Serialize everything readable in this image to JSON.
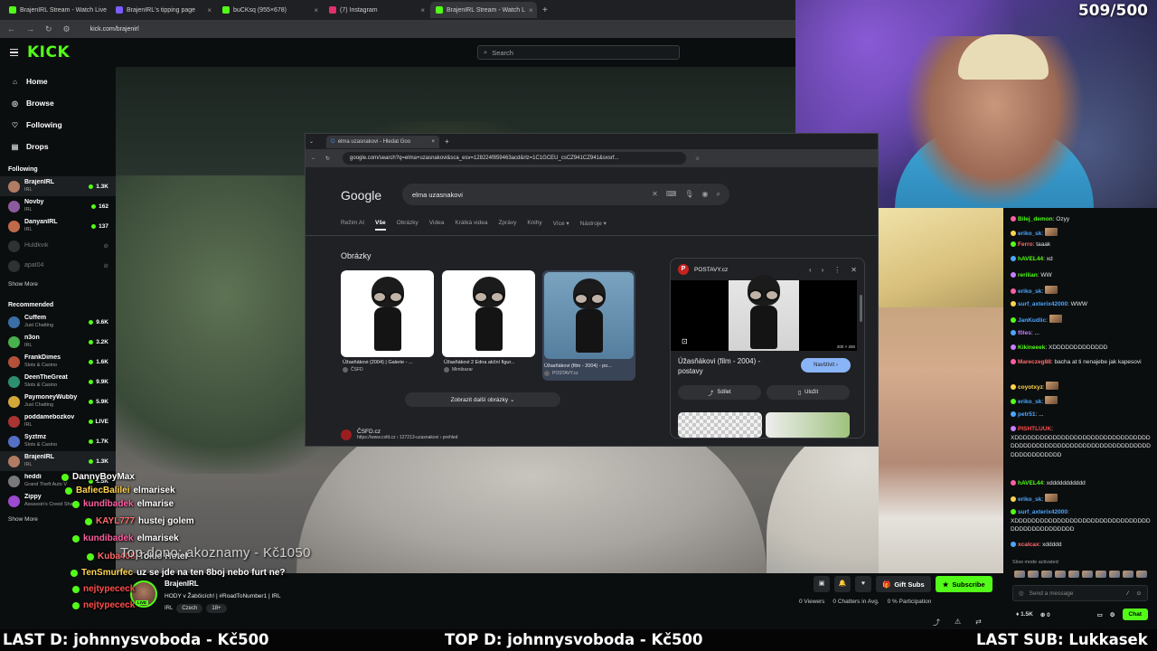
{
  "browser": {
    "tabs": [
      {
        "title": "BrajenIRL Stream - Watch Live",
        "color": "#53fc18"
      },
      {
        "title": "BrajenIRL's tipping page",
        "color": "#7b5cff"
      },
      {
        "title": "buCKsq (955×678)",
        "color": "#53fc18"
      },
      {
        "title": "(7) Instagram",
        "color": "#e1306c"
      },
      {
        "title": "BrajenIRL Stream - Watch L",
        "color": "#53fc18"
      }
    ],
    "url": "kick.com/brajenirl"
  },
  "kick": {
    "logo": "KICK",
    "search_placeholder": "Search",
    "nav": [
      {
        "label": "Home",
        "icon": "⌂"
      },
      {
        "label": "Browse",
        "icon": "◎"
      },
      {
        "label": "Following",
        "icon": "♡"
      },
      {
        "label": "Drops",
        "icon": "▤"
      }
    ],
    "following_title": "Following",
    "following": [
      {
        "name": "BrajenIRL",
        "cat": "IRL",
        "viewers": "1.3K",
        "live": true,
        "color": "#b07c63"
      },
      {
        "name": "Novby",
        "cat": "IRL",
        "viewers": "162",
        "live": true,
        "color": "#8c5a9e"
      },
      {
        "name": "DanyanIRL",
        "cat": "IRL",
        "viewers": "137",
        "live": true,
        "color": "#c06a4a"
      },
      {
        "name": "Huldkvik",
        "cat": "",
        "viewers": "",
        "live": false,
        "color": "#666"
      },
      {
        "name": "apat04",
        "cat": "",
        "viewers": "",
        "live": false,
        "color": "#666"
      }
    ],
    "show_more": "Show More",
    "recommended_title": "Recommended",
    "recommended": [
      {
        "name": "Cuffem",
        "cat": "Just Chatting",
        "viewers": "9.6K",
        "color": "#3a6ea5"
      },
      {
        "name": "n3on",
        "cat": "IRL",
        "viewers": "3.2K",
        "color": "#48b04d"
      },
      {
        "name": "FrankDimes",
        "cat": "Slots & Casino",
        "viewers": "1.6K",
        "color": "#b3513a"
      },
      {
        "name": "DeenTheGreat",
        "cat": "Slots & Casino",
        "viewers": "9.9K",
        "color": "#2d8f6f"
      },
      {
        "name": "PaymoneyWubby",
        "cat": "Just Chatting",
        "viewers": "5.9K",
        "color": "#d4a73a"
      },
      {
        "name": "poddamebozkov",
        "cat": "IRL",
        "viewers": "LIVE",
        "color": "#a33"
      },
      {
        "name": "Syztmz",
        "cat": "Slots & Casino",
        "viewers": "1.7K",
        "color": "#5470c6"
      },
      {
        "name": "BrajenIRL",
        "cat": "IRL",
        "viewers": "1.3K",
        "color": "#b07c63"
      },
      {
        "name": "heddi",
        "cat": "Grand Theft Auto V",
        "viewers": "1.5K",
        "color": "#7a7a7a"
      },
      {
        "name": "Zippy",
        "cat": "Assassin's Creed Shad...",
        "viewers": "",
        "color": "#9c4ad0"
      }
    ],
    "show_more2": "Show More"
  },
  "webcam": {
    "goal": "509/500"
  },
  "google": {
    "tab_title": "elma uzasnakovi - Hledat Goo",
    "url": "google.com/search?q=elma+uzasnakovi&sca_esv=128224f859463acd&rlz=1C1GCEU_csCZ941CZ941&sxsrf...",
    "logo": "Google",
    "query": "elma uzasnakovi",
    "filters": [
      "Režim AI",
      "Vše",
      "Obrázky",
      "Videa",
      "Krátká videa",
      "Zprávy",
      "Knihy",
      "Více ▾",
      "Nástroje ▾"
    ],
    "images_title": "Obrázky",
    "images": [
      {
        "caption": "Úžasňákovi (2004) | Galerie - ...",
        "source": "ČSFD"
      },
      {
        "caption": "Úžasňákovi 2 Edna akční figur...",
        "source": "Mimibazar"
      },
      {
        "caption": "Úžasňákovi (film - 2004) - po...",
        "source": "POSTAVY.cz"
      }
    ],
    "more_images": "Zobrazit další obrázky ⌄",
    "result_site": "ČSFD.cz",
    "result_url": "https://www.csfd.cz › 127213-uzasnakovi › prehled",
    "panel": {
      "site": "POSTAVY.cz",
      "dimensions": "200 × 200",
      "title": "Úžasňákovi (film - 2004) - postavy",
      "visit": "Navštívit ›",
      "share": "Sdílet",
      "save": "Uložit"
    }
  },
  "overlay": {
    "chat": [
      {
        "user": "DannyBoyMax",
        "msg": "",
        "ucolor": "#ffffff"
      },
      {
        "user": "BafiecBalilei",
        "msg": "elmarisek",
        "ucolor": "#ffd34d"
      },
      {
        "user": "kundibadek",
        "msg": "elmarise",
        "ucolor": "#ff5fa2"
      },
      {
        "user": "KAYL777",
        "msg": "hustej golem",
        "ucolor": "#ff6b6b"
      },
      {
        "user": "kundibadek",
        "msg": "elmarisek",
        "ucolor": "#ff5fa2"
      },
      {
        "user": "Kuba408",
        "msg": "Tokio Hotel",
        "ucolor": "#ff6b6b"
      },
      {
        "user": "TenSmurfec",
        "msg": "uz se jde na ten 8boj nebo furt ne?",
        "ucolor": "#ffd34d"
      },
      {
        "user": "nejtypececk",
        "msg": "",
        "ucolor": "#ff4d4d"
      },
      {
        "user": "nejtypececk",
        "msg": "",
        "ucolor": "#ff4d4d"
      }
    ],
    "top_dono": "Top dono: akoznamy - Kč1050"
  },
  "stream": {
    "name": "BrajenIRL",
    "title": "HODY v Žabčicích! | #RoadToNumber1 | IRL",
    "tags": [
      "IRL",
      "Czech",
      "18+"
    ],
    "gift": "Gift Subs",
    "subscribe": "Subscribe",
    "viewers": "0 Viewers",
    "chatters": "0 Chatters in Avg.",
    "participation": "0 % Participation"
  },
  "chat": {
    "messages": [
      {
        "user": "Bilej_demon",
        "text": "Ozyy",
        "color": "#53fc18"
      },
      {
        "user": "eriko_sk",
        "text": "",
        "color": "#4da6ff",
        "emote": true
      },
      {
        "user": "Ferro",
        "text": "taaak",
        "color": "#ff6b6b"
      },
      {
        "user": "hAVEL44",
        "text": "xd",
        "color": "#53fc18"
      },
      {
        "user": "rerilian",
        "text": "WW",
        "color": "#53fc18"
      },
      {
        "user": "eriko_sk",
        "text": "",
        "color": "#4da6ff",
        "emote": true
      },
      {
        "user": "surf_axterix42000",
        "text": "WWW",
        "color": "#4da6ff"
      },
      {
        "user": "JanKudlic",
        "text": "",
        "color": "#4da6ff",
        "emote": true
      },
      {
        "user": "f0les",
        "text": "...",
        "color": "#c77dff"
      },
      {
        "user": "Kikineeek",
        "text": "XDDDDDDDDDDDDD",
        "color": "#53fc18"
      },
      {
        "user": "Mareczeg88",
        "text": "bacha at ti nenajebe jak kapesovi",
        "color": "#ff6b6b"
      },
      {
        "user": "coyotxyz",
        "text": "",
        "color": "#ffd34d",
        "emote": true
      },
      {
        "user": "eriko_sk",
        "text": "",
        "color": "#4da6ff",
        "emote": true
      },
      {
        "user": "petr51",
        "text": "...",
        "color": "#4da6ff"
      },
      {
        "user": "PISHTLUUK",
        "text": "XDDDDDDDDDDDDDDDDDDDDDDDDDDDDDDDDDDDDDDDDDDDDDDDDDDDDDDDDDDDDDDDDDDDDDDDDDDDDD",
        "color": "#ff4d4d"
      },
      {
        "user": "hAVEL44",
        "text": "xddddddddddd",
        "color": "#53fc18"
      },
      {
        "user": "eriko_sk",
        "text": "",
        "color": "#4da6ff",
        "emote": true
      },
      {
        "user": "surf_axterix42000",
        "text": "XDDDDDDDDDDDDDDDDDDDDDDDDDDDDDDDDDDDDDDDDDDDDDDD",
        "color": "#4da6ff"
      },
      {
        "user": "xcalcax",
        "text": "xddddd",
        "color": "#ff6b6b"
      }
    ],
    "slow_mode": "Slow mode activated",
    "input_placeholder": "Send a message",
    "followers": "1.5K",
    "zero": "0",
    "chat_button": "Chat"
  },
  "ticker": {
    "last_d": "LAST D: johnnysvoboda - Kč500",
    "top_d": "TOP D: johnnysvoboda - Kč500",
    "last_sub": "LAST SUB: Lukkasek"
  }
}
